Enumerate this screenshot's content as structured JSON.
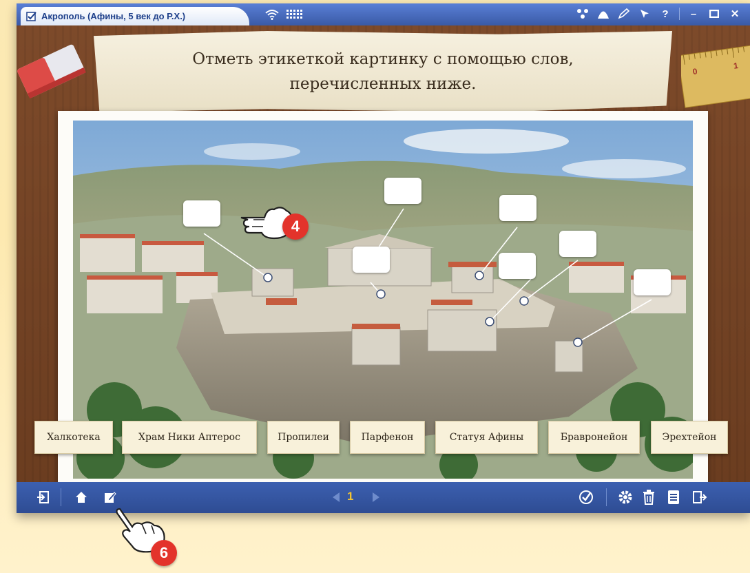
{
  "window": {
    "title": "Акрополь (Афины, 5 век до Р.Х.)",
    "titlebar_icons": [
      "network-icon",
      "bell-curve-icon",
      "pen-icon",
      "pointer-icon",
      "help-icon",
      "minimize-icon",
      "maximize-icon",
      "close-icon"
    ],
    "help_glyph": "?",
    "min_glyph": "–",
    "close_glyph": "✕"
  },
  "banner": {
    "instruction_line1": "Отметь этикеткой картинку с помощью слов,",
    "instruction_line2": "перечисленных ниже."
  },
  "ruler": {
    "mark_0": "0",
    "mark_1": "1"
  },
  "word_bank": [
    "Халкотека",
    "Храм Ники Аптерос",
    "Пропилеи",
    "Парфенон",
    "Статуя Афины",
    "Бравронейон",
    "Эрехтейон"
  ],
  "label_targets_count": 7,
  "bottombar": {
    "page_number": "1",
    "left_icons": [
      "exit-icon",
      "home-icon",
      "edit-icon"
    ],
    "right_icons": [
      "check-icon",
      "settings-icon",
      "trash-icon",
      "notes-icon",
      "next-section-icon"
    ]
  },
  "callouts": {
    "first": "4",
    "second": "6"
  },
  "colors": {
    "titlebar": "#3a5aa6",
    "bottombar": "#2e4c93",
    "board": "#6b3d20",
    "page_number": "#f3c432",
    "callout": "#e3332b"
  }
}
